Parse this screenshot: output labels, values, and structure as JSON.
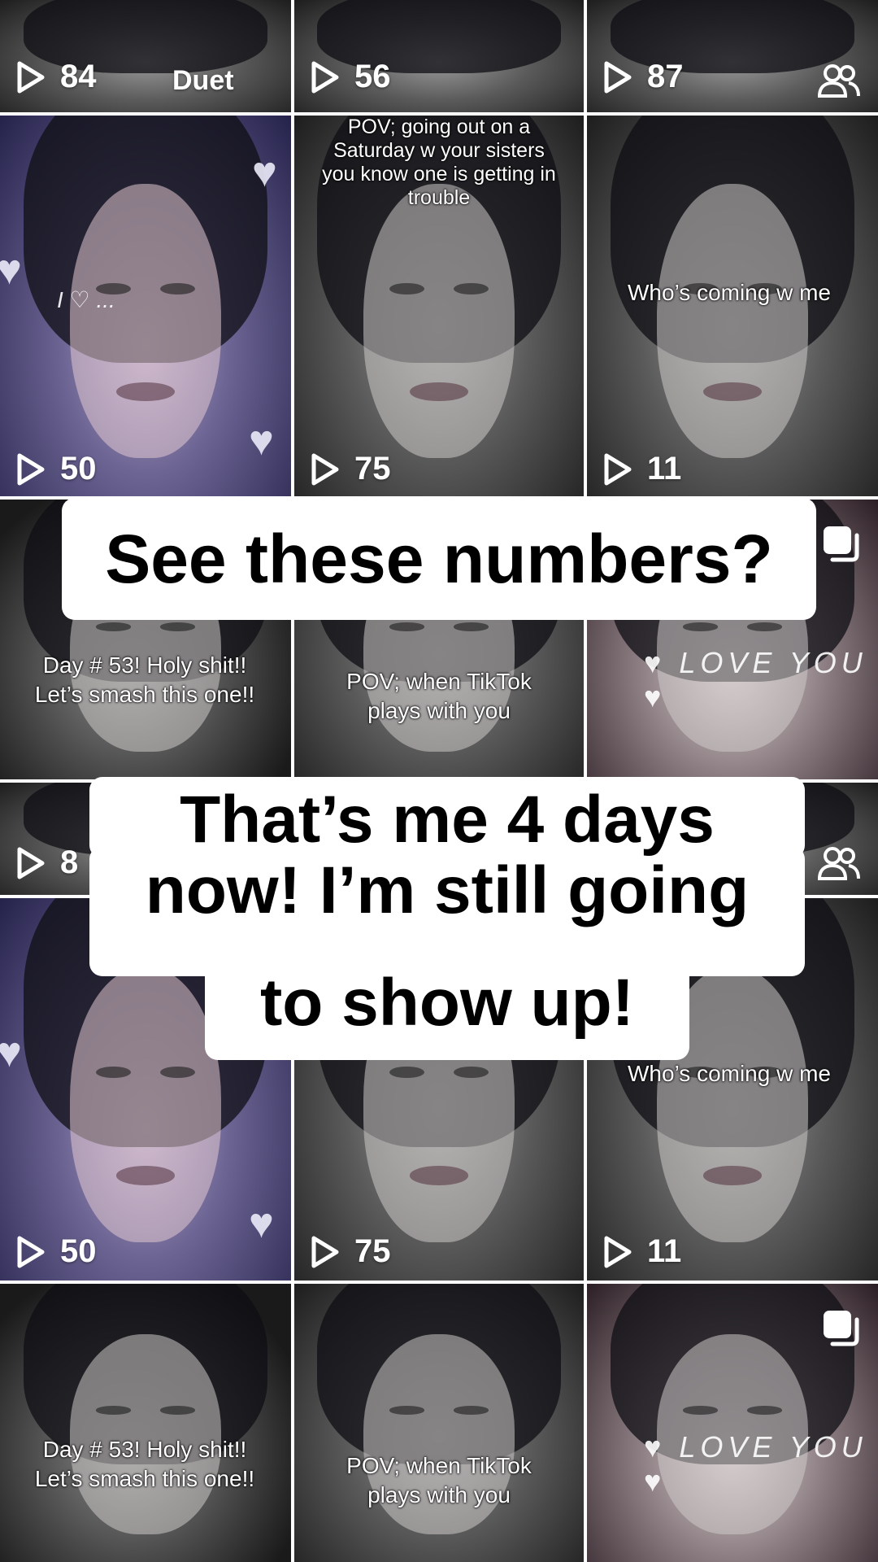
{
  "overlay": {
    "headline": "See these numbers?",
    "subline_1": "That’s me 4 days",
    "subline_2": "now! I’m still going",
    "subline_3": "to show up!"
  },
  "rows": [
    {
      "tiles": [
        {
          "views": "84",
          "badge": "Duet"
        },
        {
          "views": "56"
        },
        {
          "views": "87",
          "icon": "people-icon"
        }
      ]
    },
    {
      "tiles": [
        {
          "views": "50",
          "overlay": "I ♡ ..."
        },
        {
          "views": "75",
          "caption": "POV; going out on a Saturday w your sisters you know one is getting in trouble"
        },
        {
          "views": "11",
          "caption": "Who’s coming w me"
        }
      ]
    },
    {
      "tiles": [
        {
          "caption": "Day # 53! Holy shit!! Let’s smash this one!!"
        },
        {
          "caption": "POV; when TikTok plays with you"
        },
        {
          "overlay": "♥ LOVE  YOU ♥",
          "icon": "multi-photo-icon"
        }
      ]
    },
    {
      "tiles": [
        {
          "views": "8"
        },
        {},
        {
          "icon": "people-icon"
        }
      ]
    },
    {
      "tiles": [
        {
          "views": "50"
        },
        {
          "views": "75"
        },
        {
          "views": "11",
          "caption": "Who’s coming w me"
        }
      ]
    },
    {
      "tiles": [
        {
          "caption": "Day # 53! Holy shit!! Let’s smash this one!!"
        },
        {
          "caption": "POV; when TikTok plays with you"
        },
        {
          "overlay": "♥ LOVE  YOU ♥",
          "icon": "multi-photo-icon"
        }
      ]
    }
  ]
}
